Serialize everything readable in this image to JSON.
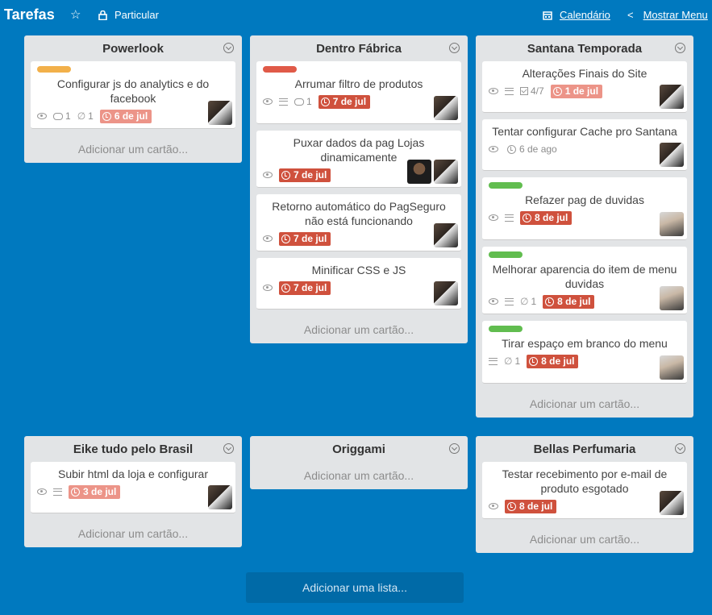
{
  "header": {
    "board_title": "Tarefas",
    "privacy": "Particular",
    "calendar": "Calendário",
    "menu": "Mostrar Menu"
  },
  "add_card_label": "Adicionar um cartão...",
  "add_list_label": "Adicionar uma lista...",
  "colors": {
    "background": "#0079bf",
    "label_orange": "#f2b04a",
    "label_red": "#e05a48",
    "label_green": "#61bd4f",
    "due_overdue": "#cf513d",
    "due_past": "#ec9488"
  },
  "lists": [
    {
      "title": "Powerlook",
      "cards": [
        {
          "label": "orange",
          "title": "Configurar js do analytics e do facebook",
          "watch": true,
          "comments": "1",
          "attachments": "1",
          "due": "6 de jul",
          "due_style": "past",
          "members": [
            "avatar"
          ]
        }
      ]
    },
    {
      "title": "Dentro Fábrica",
      "cards": [
        {
          "label": "red",
          "title": "Arrumar filtro de produtos",
          "watch": true,
          "desc": true,
          "comments": "1",
          "due": "7 de jul",
          "due_style": "overdue",
          "members": [
            "avatar"
          ]
        },
        {
          "title": "Puxar dados da pag Lojas dinamicamente",
          "watch": true,
          "due": "7 de jul",
          "due_style": "overdue",
          "members": [
            "avatar3",
            "avatar"
          ]
        },
        {
          "title": "Retorno automático do PagSeguro não está funcionando",
          "watch": true,
          "due": "7 de jul",
          "due_style": "overdue",
          "members": [
            "avatar"
          ]
        },
        {
          "title": "Minificar CSS e JS",
          "watch": true,
          "due": "7 de jul",
          "due_style": "overdue",
          "members": [
            "avatar"
          ]
        }
      ]
    },
    {
      "title": "Santana Temporada",
      "cards": [
        {
          "title": "Alterações Finais do Site",
          "watch": true,
          "desc": true,
          "checklist": "4/7",
          "due": "1 de jul",
          "due_style": "past",
          "members": [
            "avatar"
          ]
        },
        {
          "title": "Tentar configurar Cache pro Santana",
          "watch": true,
          "due": "6 de ago",
          "due_style": "plain",
          "members": [
            "avatar"
          ]
        },
        {
          "label": "green",
          "title": "Refazer pag de duvidas",
          "watch": true,
          "desc": true,
          "due": "8 de jul",
          "due_style": "overdue",
          "members": [
            "avatar2"
          ]
        },
        {
          "label": "green",
          "title": "Melhorar aparencia do item de menu duvidas",
          "watch": true,
          "desc": true,
          "attachments": "1",
          "due": "8 de jul",
          "due_style": "overdue",
          "members": [
            "avatar2"
          ]
        },
        {
          "label": "green",
          "title": "Tirar espaço em branco do menu",
          "desc": true,
          "attachments": "1",
          "due": "8 de jul",
          "due_style": "overdue",
          "members": [
            "avatar2"
          ]
        }
      ]
    },
    {
      "title": "Eike tudo pelo Brasil",
      "cards": [
        {
          "title": "Subir html da loja e configurar",
          "watch": true,
          "desc": true,
          "due": "3 de jul",
          "due_style": "past",
          "members": [
            "avatar"
          ]
        }
      ]
    },
    {
      "title": "Origgami",
      "cards": []
    },
    {
      "title": "Bellas Perfumaria",
      "cards": [
        {
          "title": "Testar recebimento por e-mail de produto esgotado",
          "watch": true,
          "due": "8 de jul",
          "due_style": "overdue",
          "members": [
            "avatar"
          ]
        }
      ]
    }
  ]
}
